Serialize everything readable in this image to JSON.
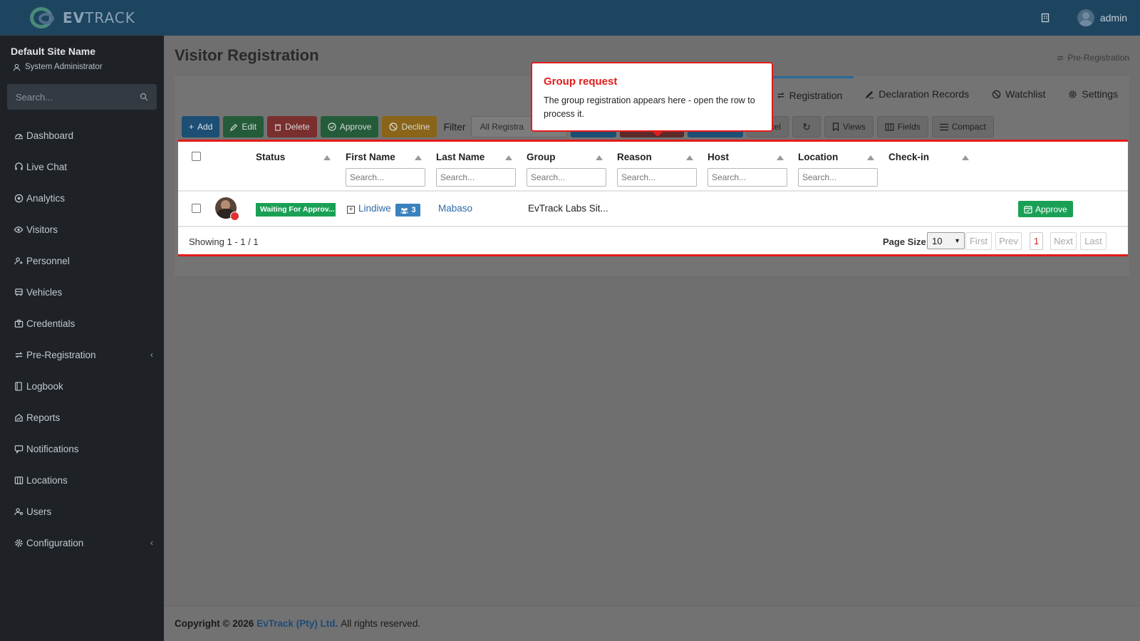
{
  "brand": {
    "logo_text_bold": "EV",
    "logo_text_rest": "TRACK"
  },
  "sidebar": {
    "site_name": "Default Site Name",
    "role": "System Administrator",
    "search_placeholder": "Search...",
    "items": [
      {
        "label": "Dashboard",
        "icon": "dashboard-icon"
      },
      {
        "label": "Live Chat",
        "icon": "headset-icon"
      },
      {
        "label": "Analytics",
        "icon": "analytics-icon"
      },
      {
        "label": "Visitors",
        "icon": "eye-icon"
      },
      {
        "label": "Personnel",
        "icon": "personnel-icon"
      },
      {
        "label": "Vehicles",
        "icon": "vehicle-icon"
      },
      {
        "label": "Credentials",
        "icon": "credential-icon"
      },
      {
        "label": "Pre-Registration",
        "icon": "swap-icon"
      },
      {
        "label": "Logbook",
        "icon": "book-icon"
      },
      {
        "label": "Reports",
        "icon": "reports-icon"
      },
      {
        "label": "Notifications",
        "icon": "notifications-icon"
      },
      {
        "label": "Locations",
        "icon": "locations-icon"
      },
      {
        "label": "Users",
        "icon": "users-icon"
      },
      {
        "label": "Configuration",
        "icon": "gear-icon"
      }
    ]
  },
  "topbar": {
    "user_name": "admin"
  },
  "page": {
    "title": "Visitor Registration",
    "prereg_link": "Pre-Registration"
  },
  "tabs": [
    {
      "label": "Registration",
      "active": true
    },
    {
      "label": "Declaration Records"
    },
    {
      "label": "Watchlist"
    },
    {
      "label": "Settings"
    }
  ],
  "toolbar": {
    "add": "Add",
    "edit": "Edit",
    "delete": "Delete",
    "approve": "Approve",
    "decline": "Decline",
    "filter_label": "Filter",
    "filter_value": "All Registra",
    "excel": "Excel",
    "views": "Views",
    "fields": "Fields",
    "compact": "Compact"
  },
  "table": {
    "columns": [
      "Status",
      "First Name",
      "Last Name",
      "Group",
      "Reason",
      "Host",
      "Location",
      "Check-in"
    ],
    "search_placeholder": "Search...",
    "rows": [
      {
        "status": "Waiting For Approv...",
        "first_name": "Lindiwe",
        "group_count": "3",
        "last_name": "Mabaso",
        "group": "EvTrack Labs Sit...",
        "action": "Approve"
      }
    ],
    "showing": "Showing 1 - 1 / 1",
    "page_size_label": "Page Size",
    "page_size": "10",
    "pager": {
      "first": "First",
      "prev": "Prev",
      "current": "1",
      "next": "Next",
      "last": "Last"
    }
  },
  "tooltip": {
    "title": "Group request",
    "body": "The group registration appears here - open the row to process it."
  },
  "footer": {
    "copyright": "Copyright © 2026",
    "company": "EvTrack (Pty) Ltd.",
    "rights": "All rights reserved."
  },
  "colors": {
    "accent": "#2f6aa8",
    "highlight": "#e31b1b",
    "success": "#1aa055"
  }
}
